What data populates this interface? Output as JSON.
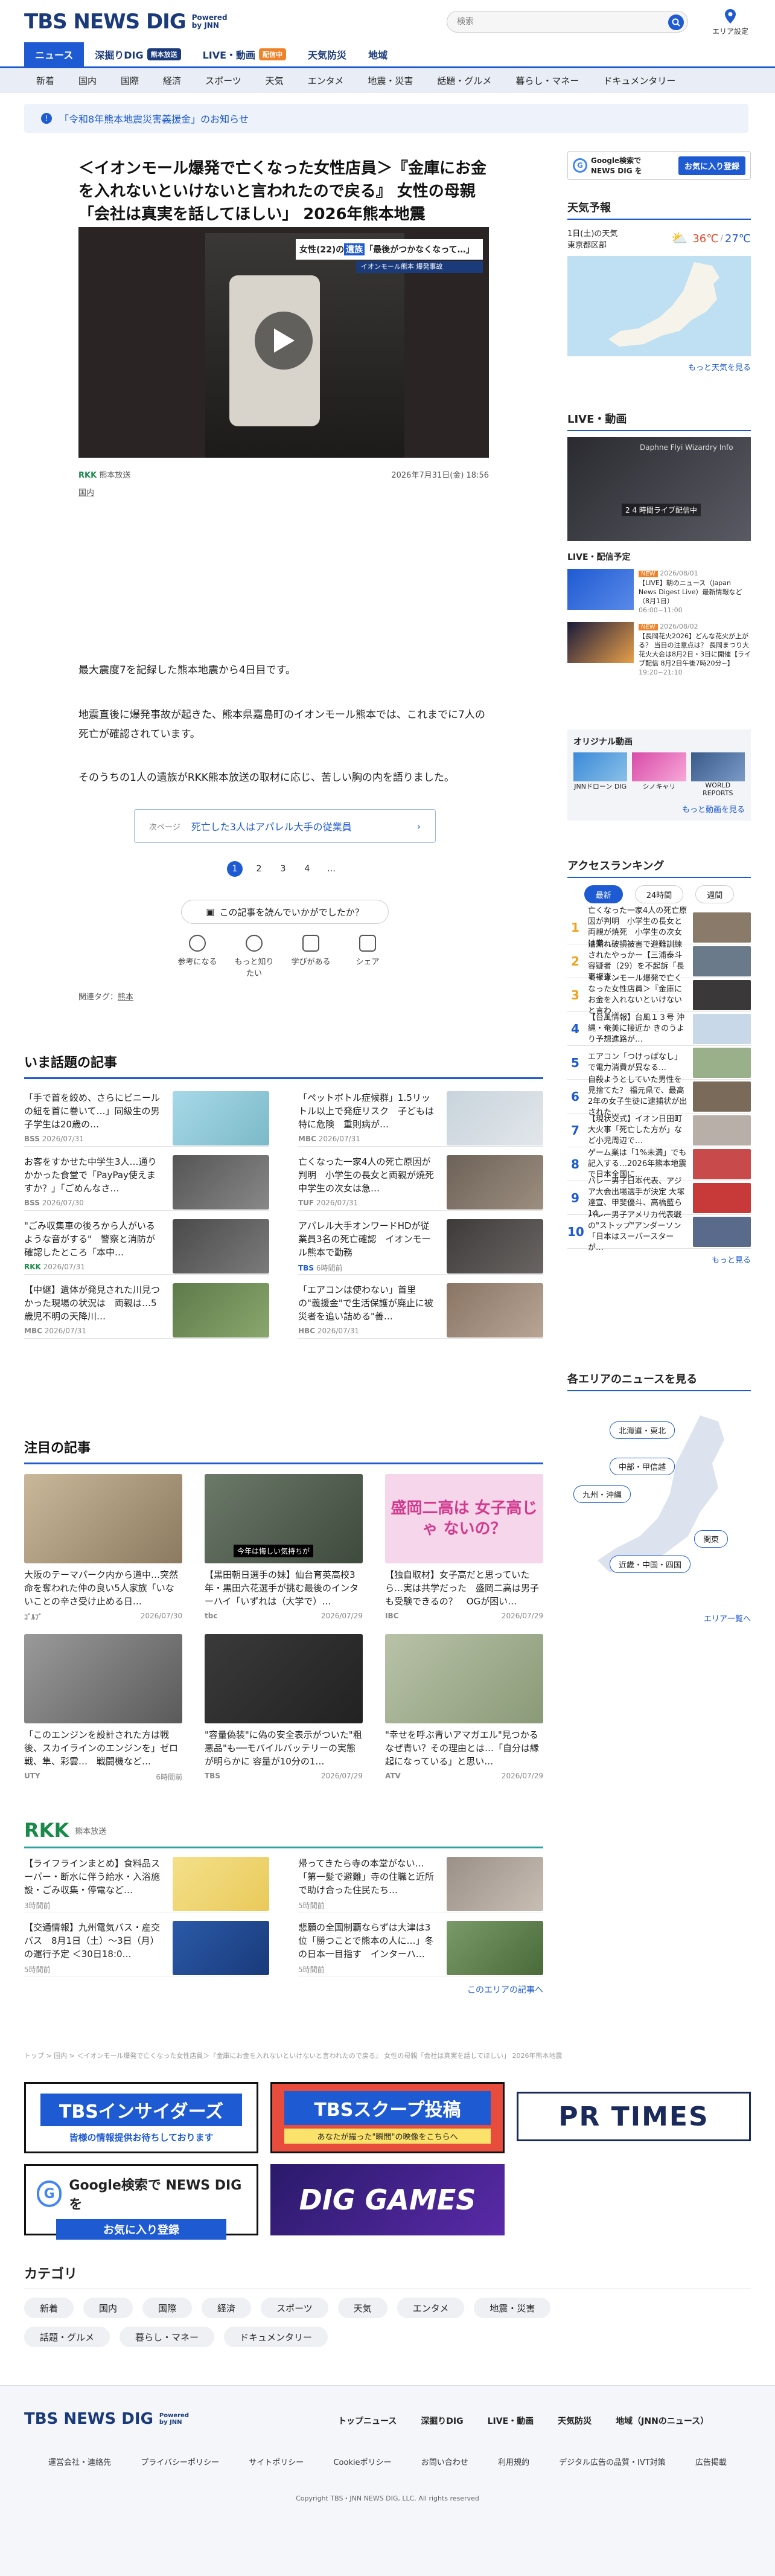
{
  "header": {
    "logo": "TBS NEWS DIG",
    "powered": "Powered by JNN",
    "search_placeholder": "検索",
    "area_setting": "エリア設定"
  },
  "nav1": [
    {
      "label": "ニュース"
    },
    {
      "label": "深掘りDIG",
      "badge": "熊本放送"
    },
    {
      "label": "LIVE・動画",
      "badge": "配信中"
    },
    {
      "label": "天気防災"
    },
    {
      "label": "地域"
    }
  ],
  "nav2": [
    "新着",
    "国内",
    "国際",
    "経済",
    "スポーツ",
    "天気",
    "エンタメ",
    "地震・災害",
    "話題・グルメ",
    "暮らし・マネー",
    "ドキュメンタリー"
  ],
  "notice": "「令和8年熊本地震災害義援金」のお知らせ",
  "article": {
    "title": "＜イオンモール爆発で亡くなった女性店員＞『金庫にお金を入れないといけないと言われたので戻る』 女性の母親「会社は真実を話してほしい」 2026年熊本地震",
    "video_caption_1": "女性(22)の",
    "video_caption_2": "遺族",
    "video_caption_3": "「最後がつかなくなって…」",
    "video_sub": "イオンモール熊本 爆発事故",
    "station": "RKK",
    "station_name": "熊本放送",
    "date": "2026年7月31日(金) 18:56",
    "category": "国内",
    "p1": "最大震度7を記録した熊本地震から4日目です。",
    "p2": "地震直後に爆発事故が起きた、熊本県嘉島町のイオンモール熊本では、これまでに7人の死亡が確認されています。",
    "p3": "そのうちの1人の遺族がRKK熊本放送の取材に応じ、苦しい胸の内を語りました。",
    "next_label": "次ページ",
    "next_title": "死亡した3人はアパレル大手の従業員",
    "pages": [
      "1",
      "2",
      "3",
      "4",
      "…"
    ],
    "feedback": "この記事を読んでいかがでしたか？",
    "reactions": [
      "参考になる",
      "もっと知りたい",
      "学びがある",
      "シェア"
    ],
    "tag_label": "関連タグ：",
    "tag": "熊本"
  },
  "hot": {
    "heading": "いま話題の記事",
    "items": [
      {
        "title": "「手で首を絞め、さらにビニールの紐を首に巻いて…」同級生の男子学生は20歳の…",
        "src": "BSS",
        "date": "2026/07/31"
      },
      {
        "title": "「ペットボトル症候群」1.5リットル以上で発症リスク　子どもは特に危険　重則病が…",
        "src": "MBC",
        "date": "2026/07/31"
      },
      {
        "title": "お客をすかせた中学生3人…通りかかった食堂で「PayPay使えますか？」「ごめんなさ…",
        "src": "BSS",
        "date": "2026/07/30"
      },
      {
        "title": "亡くなった一家4人の死亡原因が判明　小学生の長女と両親が焼死　中学生の次女は急…",
        "src": "TUF",
        "date": "2026/07/31"
      },
      {
        "title": "\"ごみ収集車の後ろから人がいるような音がする\"　警察と消防が確認したところ「本中…",
        "src": "RKK",
        "date": "2026/07/31"
      },
      {
        "title": "アパレル大手オンワードHDが従業員3名の死亡確認　イオンモール熊本で勤務",
        "src": "TBS",
        "date": "6時間前"
      },
      {
        "title": "【中継】遺体が発見された川見つかった現場の状況は　両親は…5歳児不明の天降川…",
        "src": "MBC",
        "date": "2026/07/31"
      },
      {
        "title": "「エアコンは使わない」首里の\"義援金\"で生活保護が廃止に被災者を追い詰める\"善…",
        "src": "HBC",
        "date": "2026/07/31"
      }
    ]
  },
  "featured": {
    "heading": "注目の記事",
    "items": [
      {
        "title": "大阪のテーマパーク内から道中…突然命を奪われた仲の良い5人家族「いないことの辛さ受け止める日…",
        "src": "ｺﾞﾙﾌﾞ",
        "date": "2026/07/30",
        "overlay": ""
      },
      {
        "title": "【黒田朝日選手の妹】仙台育英高校3年・黒田六花選手が挑む最後のインターハイ「いずれは（大学で）…",
        "src": "tbc",
        "date": "2026/07/29",
        "overlay": "今年は悔しい気持ちが"
      },
      {
        "title": "【独自取材】女子高だと思っていたら…実は共学だった　盛岡二高は男子も受験できるの？　OGが困い…",
        "src": "IBC",
        "date": "2026/07/29",
        "overlay": "盛岡二高は 女子高じゃ ないの？"
      },
      {
        "title": "「このエンジンを設計された方は戦後、スカイラインのエンジンを」ゼロ戦、隼、彩雲…　戦闘機など…",
        "src": "UTY",
        "date": "6時間前",
        "overlay": ""
      },
      {
        "title": "\"容量偽装\"に偽の安全表示がついた\"粗悪品\"も──モバイルバッテリーの実態が明らかに 容量が10分の1…",
        "src": "TBS",
        "date": "2026/07/29",
        "overlay": ""
      },
      {
        "title": "\"幸せを呼ぶ青いアマガエル\"見つかる　なぜ青い？その理由とは…「自分は縁起になっている」と思い…",
        "src": "ATV",
        "date": "2026/07/29",
        "overlay": ""
      }
    ]
  },
  "rkk": {
    "logo": "RKK",
    "name": "熊本放送",
    "items": [
      {
        "title": "【ライフラインまとめ】食料品スーパー・断水に伴う給水・入浴施設・ごみ収集・停電など…",
        "date": "3時間前"
      },
      {
        "title": "帰ってきたら寺の本堂がない…「第一髪で避難」寺の住職と近所で助け合った住民たち…",
        "date": "5時間前"
      },
      {
        "title": "【交通情報】九州電気バス・産交バス　8月1日（土）～3日（月）の運行予定 ＜30日18:0…",
        "date": "5時間前"
      },
      {
        "title": "悲願の全国制覇ならずは大津は3位「勝つことで熊本の人に…」冬の日本一目指す　インターハ…",
        "date": "5時間前"
      }
    ],
    "more": "このエリアの記事へ"
  },
  "breadcrumb": "トップ > 国内 > ＜イオンモール爆発で亡くなった女性店員＞『金庫にお金を入れないといけないと言われたので戻る』 女性の母親「会社は真実を話してほしい」 2026年熊本地震",
  "banners": {
    "insider_title": "TBSインサイダーズ",
    "insider_sub": "皆様の情報提供お待ちしております",
    "scoop_title": "TBSスクープ投稿",
    "scoop_sub": "あなたが撮った\"瞬間\"の映像をこちらへ",
    "prtimes": "PR TIMES",
    "google_1": "Google検索で NEWS DIG を",
    "google_btn": "お気に入り登録",
    "dig_games": "DIG GAMES"
  },
  "category": {
    "heading": "カテゴリ",
    "items": [
      "新着",
      "国内",
      "国際",
      "経済",
      "スポーツ",
      "天気",
      "エンタメ",
      "地震・災害",
      "話題・グルメ",
      "暮らし・マネー",
      "ドキュメンタリー"
    ]
  },
  "footer": {
    "nav": [
      "トップニュース",
      "深掘りDIG",
      "LIVE・動画",
      "天気防災",
      "地域（JNNのニュース）"
    ],
    "links": [
      "運営会社・連絡先",
      "プライバシーポリシー",
      "サイトポリシー",
      "Cookieポリシー",
      "お問い合わせ",
      "利用規約",
      "デジタル広告の品質・IVT対策",
      "広告掲載"
    ],
    "copy": "Copyright TBS・JNN NEWS DIG, LLC. All rights reserved"
  },
  "sidebar": {
    "google_text": "Google検索で NEWS DIG を",
    "google_btn": "お気に入り登録",
    "weather_heading": "天気予報",
    "weather_date": "1日(土)の天気",
    "weather_place": "東京都区部",
    "weather_high": "36℃",
    "weather_low": "27℃",
    "weather_more": "もっと天気を見る",
    "live_heading": "LIVE・動画",
    "live_title": "Daphne Flyi Wizardry Info",
    "live_caption": "2 4 時間ライブ配信中",
    "schedule_heading": "LIVE・配信予定",
    "sched": [
      {
        "tag": "NEW",
        "date": "2026/08/01",
        "title": "【LIVE】朝のニュース（Japan News Digest Live）最新情報など（8月1日）",
        "time": "06:00~11:00"
      },
      {
        "tag": "NEW",
        "date": "2026/08/02",
        "title": "【長岡花火2026】どんな花火が上がる？ 当日の注意点は？ 長岡まつり大花火大会は8月2日・3日に開催【ライブ配信 8月2日午後7時20分~】",
        "time": "19:20~21:10"
      }
    ],
    "original_heading": "オリジナル動画",
    "originals": [
      "JNNドローン DIG",
      "シノキャリ",
      "WORLD REPORTS"
    ],
    "orig_more": "もっと動画を見る",
    "ranking_heading": "アクセスランキング",
    "ranking_tabs": [
      "最新",
      "24時間",
      "週間"
    ],
    "ranking": [
      "亡くなった一家4人の死亡原因が判明　小学生の長女と両親が焼死　小学生の次女は拳…",
      "油漏れ破損被害で避難訓練されたやっかー【三浦泰斗容疑者（29）を不起訴「長事複查…",
      "＜イオンモール爆発で亡くなった女性店員＞『金庫にお金を入れないといけないと言わ…",
      "【台風情報】台風１３号 沖縄・奄美に接近か きのうより予想進路が…",
      "エアコン「つけっぱなし」で電力消費が異なる…",
      "自殺ようとしていた男性を見捨てた？ 福元県で、最高2年の女子生徒に逮捕状が出された…",
      "【現状交式】イオン日田町大火事「死亡した方が」など小児周辺で…",
      "ゲーム業は「1%未満」でも記入する…2026年熊本地震で日本全国に…",
      "バレー男子日本代表、アジア大会出場選手が決定 大塚達宣、甲斐優斗、高橋藍ら14…",
      "バレー男子アメリカ代表戦の\"ストップ\"アンダーソン「日本はスーパースターが…"
    ],
    "ranking_more": "もっと見る",
    "area_heading": "各エリアのニュースを見る",
    "areas": [
      "北海道・東北",
      "中部・甲信越",
      "九州・沖縄",
      "関東",
      "近畿・中国・四国"
    ],
    "area_more": "エリア一覧へ"
  },
  "colors": {
    "brand": "#1a3a7a",
    "accent": "#1e5ad2",
    "live": "#f0822a",
    "rank": "#f0a21a"
  }
}
